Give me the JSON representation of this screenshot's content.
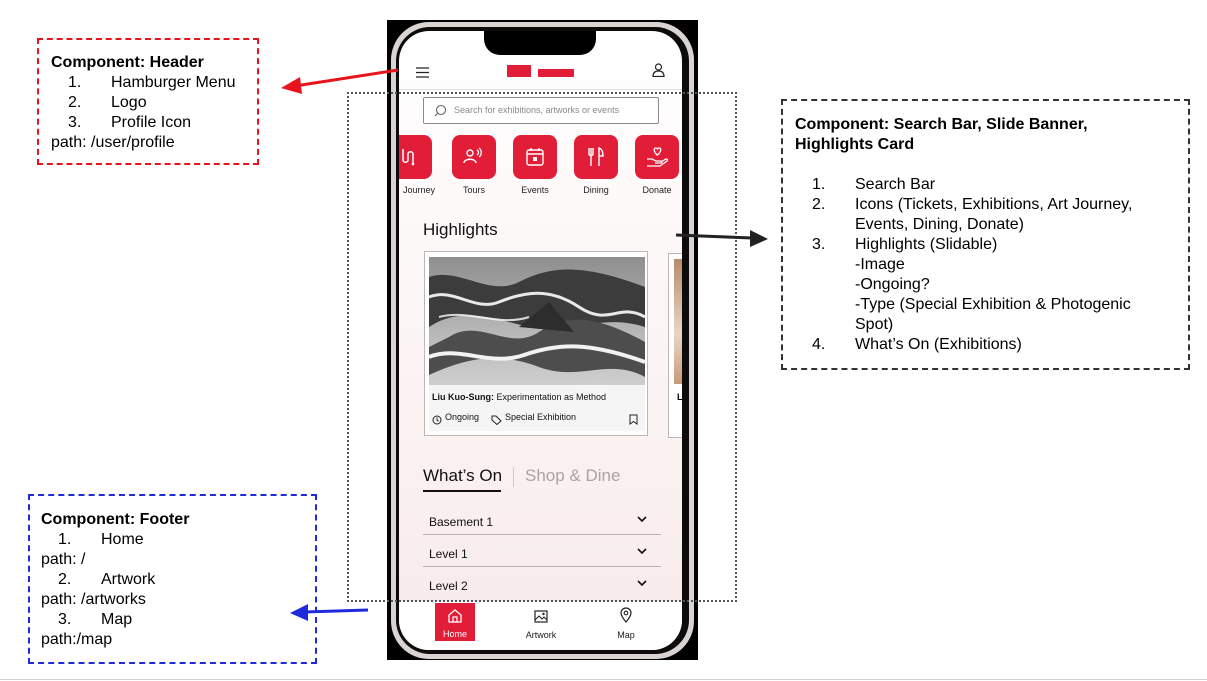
{
  "annotations": {
    "header": {
      "title": "Component: Header",
      "items": [
        {
          "num": "1.",
          "label": "Hamburger Menu"
        },
        {
          "num": "2.",
          "label": "Logo"
        },
        {
          "num": "3.",
          "label": "Profile Icon"
        }
      ],
      "path": "path: /user/profile",
      "color": "#e8141d"
    },
    "main": {
      "title_line1": "Component: Search Bar, Slide Banner,",
      "title_line2": "Highlights Card",
      "items": [
        {
          "num": "1.",
          "label": "Search Bar"
        },
        {
          "num": "2.",
          "label": "Icons (Tickets, Exhibitions, Art Journey, Events, Dining, Donate)"
        },
        {
          "num": "3.",
          "label": "Highlights (Slidable)"
        },
        {
          "num": "4.",
          "label": "What’s On (Exhibitions)"
        }
      ],
      "highlight_subitems": [
        "-Image",
        "-Ongoing?",
        "-Type (Special Exhibition & Photogenic Spot)"
      ],
      "color": "#333333"
    },
    "footer": {
      "title": "Component: Footer",
      "items": [
        {
          "num": "1.",
          "label": "Home",
          "path": "path: /"
        },
        {
          "num": "2.",
          "label": "Artwork",
          "path": "path: /artworks"
        },
        {
          "num": "3.",
          "label": "Map",
          "path": "path:/map"
        }
      ],
      "color": "#1f2bdb"
    }
  },
  "phone": {
    "brand_color": "#e11d38",
    "header": {
      "menu_icon": "hamburger-icon",
      "profile_icon": "user-icon"
    },
    "search": {
      "placeholder": "Search for exhibitions, artworks or events"
    },
    "categories": [
      {
        "label": "Journey",
        "icon": "journey-icon"
      },
      {
        "label": "Tours",
        "icon": "tours-icon"
      },
      {
        "label": "Events",
        "icon": "calendar-icon"
      },
      {
        "label": "Dining",
        "icon": "dining-icon"
      },
      {
        "label": "Donate",
        "icon": "donate-icon"
      }
    ],
    "highlights": {
      "title": "Highlights",
      "cards": [
        {
          "artist": "Liu Kuo-Sung:",
          "subtitle": "Experimentation as Method",
          "status": "Ongoing",
          "type": "Special Exhibition"
        },
        {
          "artist": "L"
        }
      ]
    },
    "tabs": {
      "active": "What’s On",
      "inactive": "Shop & Dine"
    },
    "levels": [
      "Basement 1",
      "Level 1",
      "Level 2"
    ],
    "footer": [
      {
        "label": "Home",
        "icon": "home-icon",
        "active": true
      },
      {
        "label": "Artwork",
        "icon": "artwork-icon",
        "active": false
      },
      {
        "label": "Map",
        "icon": "map-pin-icon",
        "active": false
      }
    ]
  }
}
